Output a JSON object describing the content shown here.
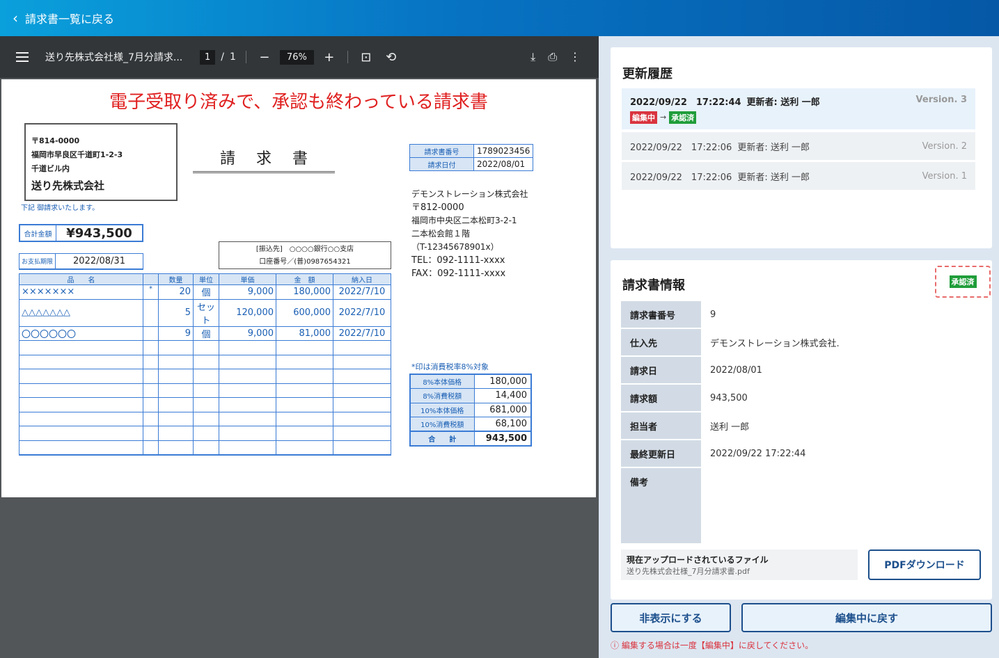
{
  "topbar": {
    "back_label": "請求書一覧に戻る"
  },
  "viewer": {
    "filename": "送り先株式会社様_7月分請求...",
    "page_current": "1",
    "page_sep": "/",
    "page_total": "1",
    "zoom": "76%",
    "document": {
      "banner": "電子受取り済みで、承認も終わっている請求書",
      "recipient": {
        "zip": "〒814-0000",
        "address1": "福岡市早良区千道町1-2-3",
        "address2": "千道ビル内",
        "name": "送り先株式会社"
      },
      "note": "下記 御請求いたします。",
      "doc_title": "請求書",
      "total_label": "合計金額",
      "total_value": "¥943,500",
      "due_label": "お支払期限",
      "due_value": "2022/08/31",
      "bank_line1": "[振込先]　○○○○銀行○○支店",
      "bank_line2": "口座番号／(普)0987654321",
      "meta": [
        {
          "label": "請求書番号",
          "value": "1789023456"
        },
        {
          "label": "請求日付",
          "value": "2022/08/01"
        }
      ],
      "sender": {
        "name": "デモンストレーション株式会社",
        "zip": "〒812-0000",
        "address1": "福岡市中央区二本松町3-2-1",
        "address2": "二本松会館１階",
        "reg": "（T-12345678901x）",
        "tel": "TEL：092-1111-xxxx",
        "fax": "FAX：092-1111-xxxx"
      },
      "item_headers": [
        "品　　名",
        "",
        "数量",
        "単位",
        "単価",
        "金　額",
        "納入日"
      ],
      "items": [
        [
          "×××××××",
          "*",
          "20",
          "個",
          "9,000",
          "180,000",
          "2022/7/10"
        ],
        [
          "△△△△△△△",
          "",
          "5",
          "セット",
          "120,000",
          "600,000",
          "2022/7/10"
        ],
        [
          "〇〇〇〇〇〇",
          "",
          "9",
          "個",
          "9,000",
          "81,000",
          "2022/7/10"
        ]
      ],
      "tax_note": "*印は消費税率8%対象",
      "tax": [
        {
          "label": "8%本体価格",
          "value": "180,000"
        },
        {
          "label": "8%消費税額",
          "value": "14,400"
        },
        {
          "label": "10%本体価格",
          "value": "681,000"
        },
        {
          "label": "10%消費税額",
          "value": "68,100"
        },
        {
          "label": "合　　計",
          "value": "943,500"
        }
      ]
    }
  },
  "history": {
    "title": "更新履歴",
    "entries": [
      {
        "datetime": "2022/09/22　17:22:44",
        "editor": "更新者: 送利 一郎",
        "version": "Version. 3",
        "from_status": "編集中",
        "arrow": "→",
        "to_status": "承認済"
      },
      {
        "datetime": "2022/09/22　17:22:06",
        "editor": "更新者: 送利 一郎",
        "version": "Version. 2"
      },
      {
        "datetime": "2022/09/22　17:22:06",
        "editor": "更新者: 送利 一郎",
        "version": "Version. 1"
      }
    ]
  },
  "info": {
    "title": "請求書情報",
    "status": "承認済",
    "rows": [
      {
        "label": "請求書番号",
        "value": "9"
      },
      {
        "label": "仕入先",
        "value": "デモンストレーション株式会社."
      },
      {
        "label": "請求日",
        "value": "2022/08/01"
      },
      {
        "label": "請求額",
        "value": "943,500"
      },
      {
        "label": "担当者",
        "value": "送利 一郎"
      },
      {
        "label": "最終更新日",
        "value": "2022/09/22 17:22:44"
      },
      {
        "label": "備考",
        "value": ""
      }
    ],
    "file_title": "現在アップロードされているファイル",
    "file_name": "送り先株式会社様_7月分請求書.pdf",
    "pdf_button": "PDFダウンロード"
  },
  "actions": {
    "hide_button": "非表示にする",
    "back_to_edit_button": "編集中に戻す",
    "warning": "ⓘ 編集する場合は一度【編集中】に戻してください。"
  },
  "colors": {
    "accent": "#1c4f8c",
    "approved": "#1f9d3a",
    "editing": "#d9343f",
    "banner": "#e02020"
  }
}
